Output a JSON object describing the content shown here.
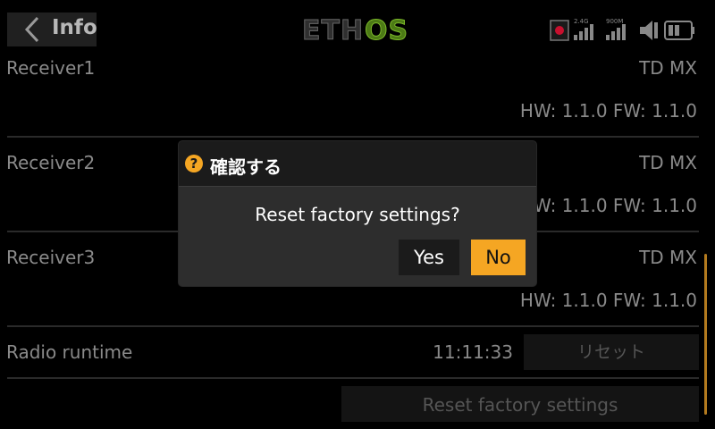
{
  "header": {
    "title": "Info",
    "logo_text": "ETHOS",
    "status": {
      "band1": "2.4G",
      "band2": "900M"
    }
  },
  "receivers": [
    {
      "name": "Receiver1",
      "model": "TD MX",
      "versions": "HW: 1.1.0 FW: 1.1.0"
    },
    {
      "name": "Receiver2",
      "model": "TD MX",
      "versions": "HW: 1.1.0 FW: 1.1.0"
    },
    {
      "name": "Receiver3",
      "model": "TD MX",
      "versions": "HW: 1.1.0 FW: 1.1.0"
    }
  ],
  "runtime": {
    "label": "Radio runtime",
    "value": "11:11:33",
    "reset_label": "リセット"
  },
  "factory_reset": {
    "label": "Reset factory settings"
  },
  "dialog": {
    "title": "確認する",
    "message": "Reset factory settings?",
    "yes_label": "Yes",
    "no_label": "No"
  },
  "colors": {
    "accent": "#f5a623",
    "logo_os": "#7dbb2a",
    "record": "#c8102e"
  }
}
